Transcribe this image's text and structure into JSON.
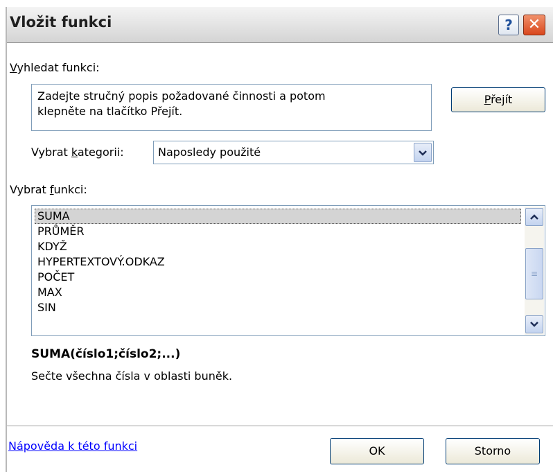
{
  "dialog": {
    "title": "Vložit funkci",
    "help_button": "?",
    "close_button": "✕"
  },
  "search": {
    "label": "Vyhledat funkci:",
    "label_accel": "V",
    "label_rest": "yhledat funkci:",
    "text": "Zadejte stručný popis požadované činnosti a potom\nklepněte na tlačítko Přejít.",
    "go_button": {
      "accel": "P",
      "rest": "řejít"
    }
  },
  "category": {
    "label_pre": "Vybrat ",
    "label_accel": "k",
    "label_rest": "ategorii:",
    "selected": "Naposledy použité"
  },
  "functions": {
    "label_pre": "Vybrat ",
    "label_accel": "f",
    "label_rest": "unkci:",
    "items": [
      "SUMA",
      "PRŮMĚR",
      "KDYŽ",
      "HYPERTEXTOVÝ.ODKAZ",
      "POČET",
      "MAX",
      "SIN"
    ],
    "selected_index": 0
  },
  "details": {
    "signature": "SUMA(číslo1;číslo2;...)",
    "description": "Sečte všechna čísla v oblasti buněk."
  },
  "footer": {
    "help_link": "Nápověda k této funkci",
    "ok": "OK",
    "cancel": "Storno"
  },
  "icons": {
    "dropdown": "chevron-down-icon",
    "scroll_up": "chevron-up-icon",
    "scroll_down": "chevron-down-icon"
  }
}
